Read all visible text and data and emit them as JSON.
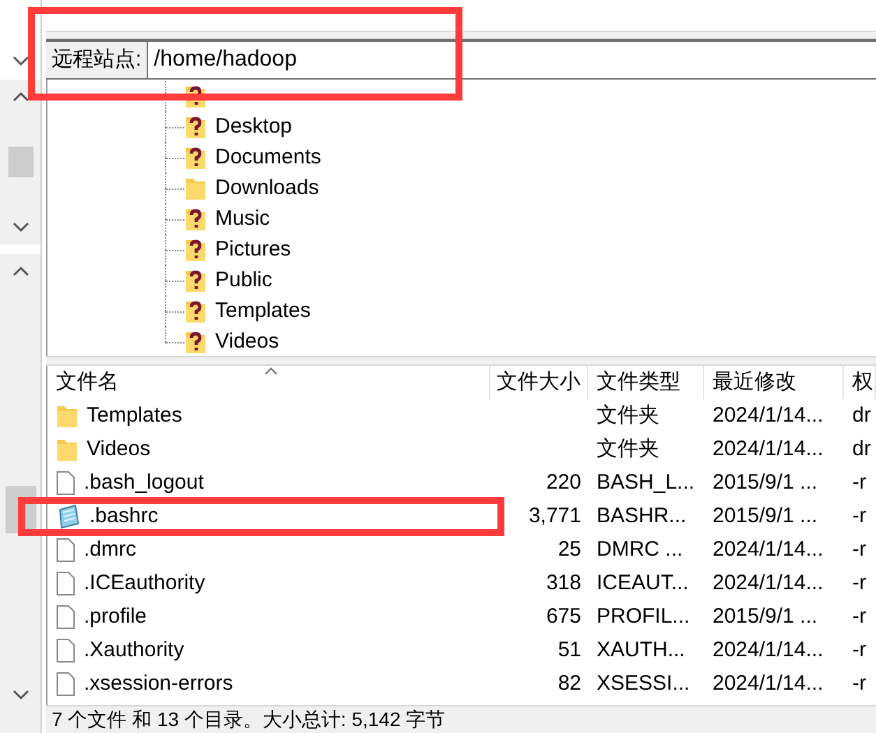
{
  "remote_site": {
    "label": "远程站点:",
    "value": "/home/hadoop",
    "highlighted": true
  },
  "tree": {
    "items": [
      {
        "kind": "unknown"
      },
      {
        "kind": "unknown",
        "label": "Desktop"
      },
      {
        "kind": "unknown",
        "label": "Documents"
      },
      {
        "kind": "folder",
        "label": "Downloads"
      },
      {
        "kind": "unknown",
        "label": "Music"
      },
      {
        "kind": "unknown",
        "label": "Pictures"
      },
      {
        "kind": "unknown",
        "label": "Public"
      },
      {
        "kind": "unknown",
        "label": "Templates"
      },
      {
        "kind": "unknown",
        "label": "Videos"
      }
    ]
  },
  "file_list": {
    "columns": [
      "文件名",
      "文件大小",
      "文件类型",
      "最近修改",
      "权"
    ],
    "rows": [
      {
        "kind": "folder",
        "name": "Templates",
        "size": "",
        "type": "文件夹",
        "modified": "2024/1/14...",
        "perms": "dr",
        "highlighted": false
      },
      {
        "kind": "folder",
        "name": "Videos",
        "size": "",
        "type": "文件夹",
        "modified": "2024/1/14...",
        "perms": "dr",
        "highlighted": false
      },
      {
        "kind": "file",
        "name": ".bash_logout",
        "size": "220",
        "type": "BASH_L...",
        "modified": "2015/9/1 ...",
        "perms": "-r",
        "highlighted": false
      },
      {
        "kind": "text-file",
        "name": ".bashrc",
        "size": "3,771",
        "type": "BASHR...",
        "modified": "2015/9/1 ...",
        "perms": "-r",
        "highlighted": true
      },
      {
        "kind": "file",
        "name": ".dmrc",
        "size": "25",
        "type": "DMRC ...",
        "modified": "2024/1/14...",
        "perms": "-r",
        "highlighted": false
      },
      {
        "kind": "file",
        "name": ".ICEauthority",
        "size": "318",
        "type": "ICEAUT...",
        "modified": "2024/1/14...",
        "perms": "-r",
        "highlighted": false
      },
      {
        "kind": "file",
        "name": ".profile",
        "size": "675",
        "type": "PROFIL...",
        "modified": "2015/9/1 ...",
        "perms": "-r",
        "highlighted": false
      },
      {
        "kind": "file",
        "name": ".Xauthority",
        "size": "51",
        "type": "XAUTH...",
        "modified": "2024/1/14...",
        "perms": "-r",
        "highlighted": false
      },
      {
        "kind": "file",
        "name": ".xsession-errors",
        "size": "82",
        "type": "XSESSI...",
        "modified": "2024/1/14...",
        "perms": "-r",
        "highlighted": false
      }
    ]
  },
  "status_bar": "7 个文件 和 13 个目录。大小总计: 5,142 字节"
}
